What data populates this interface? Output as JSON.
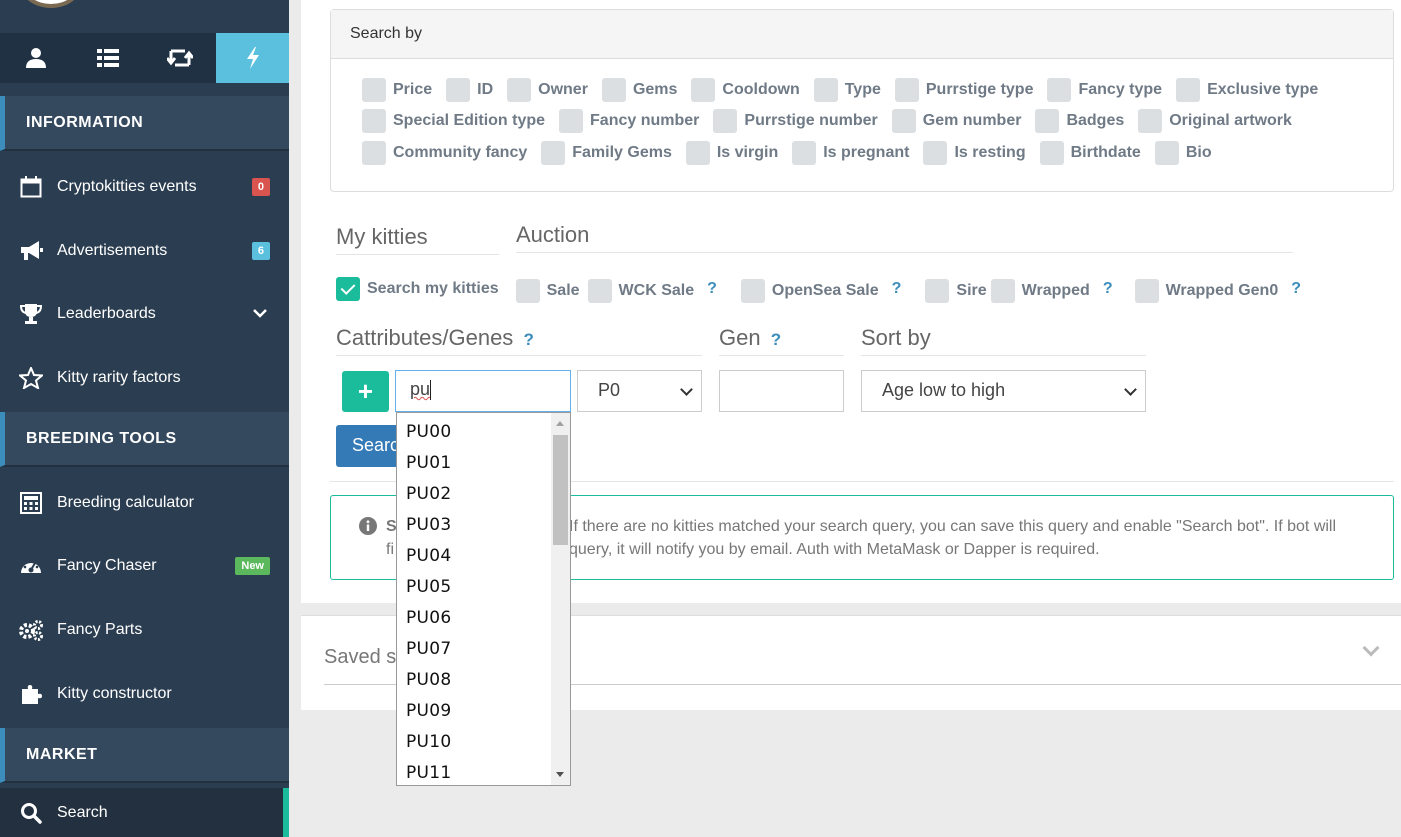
{
  "sidebar": {
    "tabs": [
      {
        "icon": "user-icon"
      },
      {
        "icon": "list-icon"
      },
      {
        "icon": "retweet-icon"
      },
      {
        "icon": "bolt-icon",
        "active": true
      }
    ],
    "sections": {
      "information": "INFORMATION",
      "breeding": "BREEDING TOOLS",
      "market": "MARKET"
    },
    "items": {
      "events": {
        "label": "Cryptokitties events",
        "badge": "0",
        "badge_color": "#d9534f"
      },
      "ads": {
        "label": "Advertisements",
        "badge": "6",
        "badge_color": "#5bc0de"
      },
      "leaderboards": {
        "label": "Leaderboards"
      },
      "rarity": {
        "label": "Kitty rarity factors"
      },
      "calculator": {
        "label": "Breeding calculator"
      },
      "chaser": {
        "label": "Fancy Chaser",
        "badge": "New",
        "badge_color": "#5cb85c"
      },
      "parts": {
        "label": "Fancy Parts"
      },
      "constructor": {
        "label": "Kitty constructor"
      },
      "search": {
        "label": "Search"
      }
    }
  },
  "search_by": {
    "title": "Search by",
    "row1": [
      "Price",
      "ID",
      "Owner",
      "Gems",
      "Cooldown",
      "Type",
      "Purrstige type",
      "Fancy type",
      "Exclusive type"
    ],
    "row2": [
      "Special Edition type",
      "Fancy number",
      "Purrstige number",
      "Gem number",
      "Badges",
      "Original artwork"
    ],
    "row3": [
      "Community fancy",
      "Family Gems",
      "Is virgin",
      "Is pregnant",
      "Is resting",
      "Birthdate",
      "Bio"
    ]
  },
  "my_kitties": {
    "title": "My kitties",
    "checkbox": "Search my kitties"
  },
  "auction": {
    "title": "Auction",
    "sale": "Sale",
    "wck_sale": "WCK Sale",
    "opensea_sale": "OpenSea Sale",
    "sire": "Sire",
    "wrapped": "Wrapped",
    "wrapped_gen0": "Wrapped Gen0",
    "help": "?"
  },
  "cattributes": {
    "title": "Cattributes/Genes",
    "help": "?",
    "add": "+",
    "input_value": "pu",
    "position_select": "P0"
  },
  "gen": {
    "title": "Gen",
    "help": "?",
    "value": ""
  },
  "sort": {
    "title": "Sort by",
    "value": "Age low to high"
  },
  "search_button": "Search",
  "info": {
    "line1_left": "S",
    "line1_right": "If there are no kitties matched your search query, you can save this query and enable \"Search bot\". If bot will",
    "line2_left": "fi",
    "line2_right": "query, it will notify you by email. Auth with MetaMask or Dapper is required."
  },
  "saved": {
    "title": "Saved s"
  },
  "autocomplete": [
    "PU00",
    "PU01",
    "PU02",
    "PU03",
    "PU04",
    "PU05",
    "PU06",
    "PU07",
    "PU08",
    "PU09",
    "PU10",
    "PU11"
  ]
}
